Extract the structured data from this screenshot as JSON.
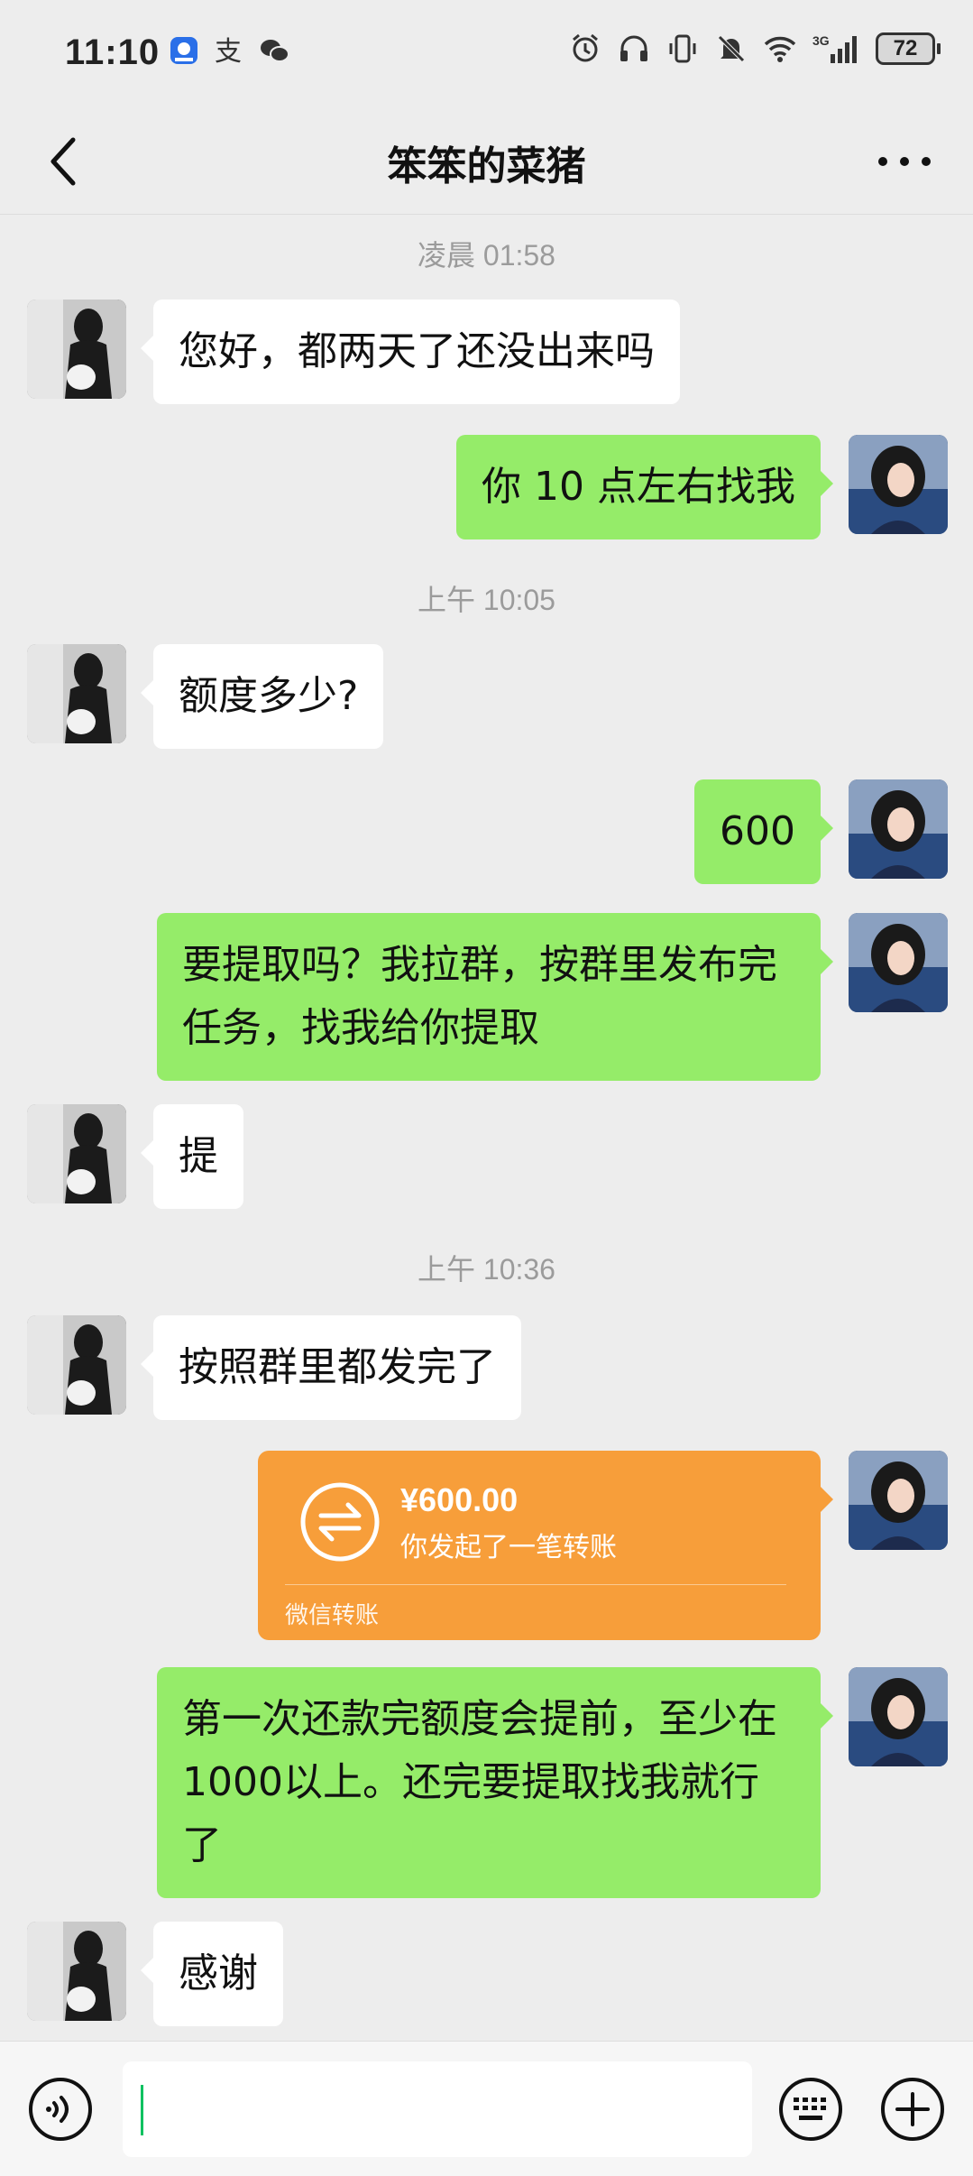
{
  "status": {
    "time": "11:10",
    "left_icons": [
      "app-badge-icon",
      "alipay-icon",
      "wechat-icon"
    ],
    "right_icons": [
      "alarm-icon",
      "headphones-icon",
      "vibrate-icon",
      "mute-icon",
      "wifi-icon",
      "signal-3g-icon"
    ],
    "network": "3G",
    "battery": "72"
  },
  "header": {
    "title": "笨笨的菜猪",
    "back_icon": "chevron-left-icon",
    "more_icon": "more-dots-icon"
  },
  "messages": [
    {
      "type": "timestamp",
      "text": "凌晨 01:58"
    },
    {
      "type": "text",
      "side": "in",
      "text": "您好，都两天了还没出来吗"
    },
    {
      "type": "text",
      "side": "out",
      "text": "你 10 点左右找我"
    },
    {
      "type": "timestamp",
      "text": "上午 10:05"
    },
    {
      "type": "text",
      "side": "in",
      "text": "额度多少?"
    },
    {
      "type": "text",
      "side": "out",
      "text": "600"
    },
    {
      "type": "text",
      "side": "out",
      "text": "要提取吗？我拉群，按群里发布完任务，找我给你提取"
    },
    {
      "type": "text",
      "side": "in",
      "text": "提"
    },
    {
      "type": "timestamp",
      "text": "上午 10:36"
    },
    {
      "type": "text",
      "side": "in",
      "text": "按照群里都发完了"
    },
    {
      "type": "transfer",
      "side": "out",
      "amount": "¥600.00",
      "desc": "你发起了一笔转账",
      "label": "微信转账"
    },
    {
      "type": "text",
      "side": "out",
      "text": "第一次还款完额度会提前，至少在1000以上。还完要提取找我就行了"
    },
    {
      "type": "text",
      "side": "in",
      "text": "感谢"
    }
  ],
  "input_bar": {
    "voice_icon": "voice-icon",
    "keyboard_icon": "keyboard-icon",
    "plus_icon": "plus-circle-icon",
    "value": ""
  },
  "colors": {
    "background": "#ededed",
    "bubble_out": "#95ec69",
    "bubble_in": "#ffffff",
    "transfer": "#f79e3a",
    "caret": "#07c160"
  }
}
